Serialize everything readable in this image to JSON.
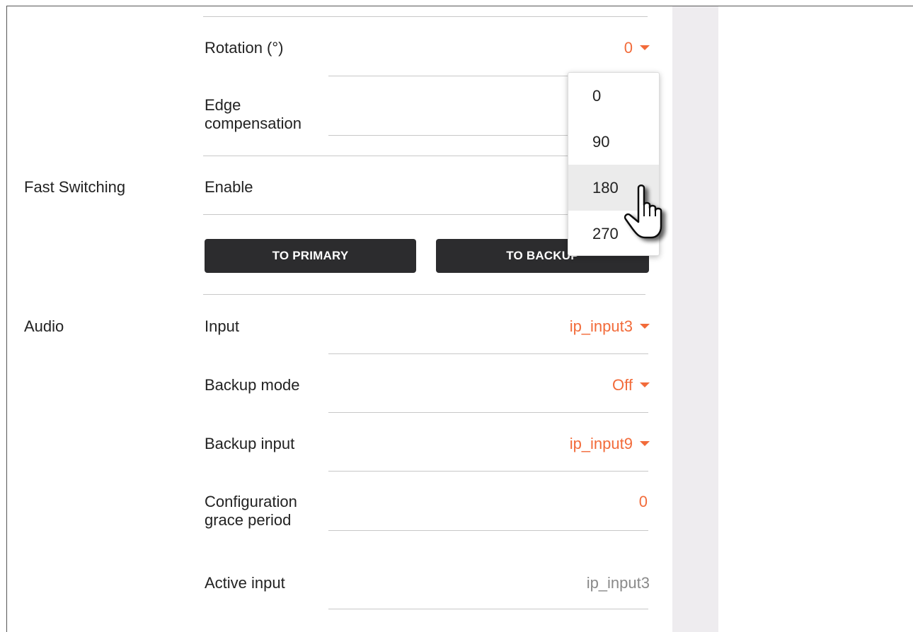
{
  "sections": {
    "fast_switching": "Fast Switching",
    "audio": "Audio"
  },
  "rows": {
    "rotation": {
      "label": "Rotation (°)",
      "value": "0"
    },
    "edge_compensation": {
      "label_line1": "Edge",
      "label_line2": "compensation"
    },
    "enable": {
      "label": "Enable"
    },
    "input": {
      "label": "Input",
      "value": "ip_input3"
    },
    "backup_mode": {
      "label": "Backup mode",
      "value": "Off"
    },
    "backup_input": {
      "label": "Backup input",
      "value": "ip_input9"
    },
    "grace_period": {
      "label_line1": "Configuration",
      "label_line2": "grace period",
      "value": "0"
    },
    "active_input": {
      "label": "Active input",
      "value": "ip_input3"
    }
  },
  "buttons": {
    "to_primary": "TO PRIMARY",
    "to_backup": "TO BACKUP"
  },
  "rotation_dropdown": {
    "options": [
      "0",
      "90",
      "180",
      "270"
    ],
    "hovered": "180"
  },
  "colors": {
    "accent": "#f26b3a",
    "button_bg": "#2c2c2e",
    "sidebar_bg": "#eeecef"
  }
}
